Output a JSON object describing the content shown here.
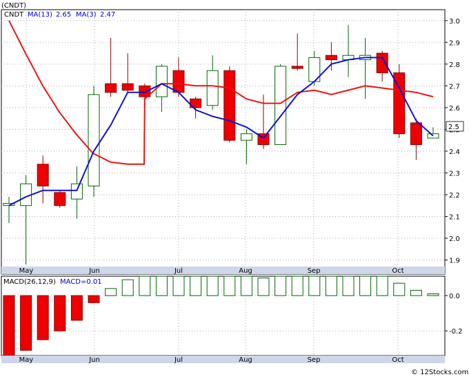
{
  "top_label": "(CNDT)",
  "copyright": "© 12Stocks.com",
  "chart_data": [
    {
      "type": "candlestick",
      "header": {
        "symbol": "CNDT",
        "ma13_label": "MA(13)",
        "ma13_value": "2.65",
        "ma3_label": "MA(3)",
        "ma3_value": "2.47"
      },
      "ylim": [
        1.87,
        3.05
      ],
      "yticks": [
        "3.0",
        "2.9",
        "2.8",
        "2.7",
        "2.6",
        "2.5",
        "2.4",
        "2.3",
        "2.2",
        "2.1",
        "2.0",
        "1.9"
      ],
      "last_price_label": "2.5",
      "months": [
        "May",
        "Jun",
        "Jul",
        "Aug",
        "Sep",
        "Oct"
      ],
      "candles": [
        {
          "o": 2.15,
          "h": 2.19,
          "l": 2.07,
          "c": 2.16
        },
        {
          "o": 2.15,
          "h": 2.29,
          "l": 1.88,
          "c": 2.25
        },
        {
          "o": 2.34,
          "h": 2.38,
          "l": 2.16,
          "c": 2.24
        },
        {
          "o": 2.21,
          "h": 2.22,
          "l": 2.14,
          "c": 2.15
        },
        {
          "o": 2.18,
          "h": 2.33,
          "l": 2.09,
          "c": 2.25
        },
        {
          "o": 2.24,
          "h": 2.7,
          "l": 2.19,
          "c": 2.66
        },
        {
          "o": 2.71,
          "h": 2.92,
          "l": 2.65,
          "c": 2.67
        },
        {
          "o": 2.71,
          "h": 2.85,
          "l": 2.67,
          "c": 2.68
        },
        {
          "o": 2.7,
          "h": 2.71,
          "l": 2.56,
          "c": 2.65
        },
        {
          "o": 2.65,
          "h": 2.8,
          "l": 2.58,
          "c": 2.79
        },
        {
          "o": 2.77,
          "h": 2.83,
          "l": 2.65,
          "c": 2.67
        },
        {
          "o": 2.64,
          "h": 2.65,
          "l": 2.55,
          "c": 2.6
        },
        {
          "o": 2.61,
          "h": 2.84,
          "l": 2.59,
          "c": 2.77
        },
        {
          "o": 2.77,
          "h": 2.79,
          "l": 2.44,
          "c": 2.45
        },
        {
          "o": 2.45,
          "h": 2.5,
          "l": 2.34,
          "c": 2.48
        },
        {
          "o": 2.48,
          "h": 2.66,
          "l": 2.41,
          "c": 2.43
        },
        {
          "o": 2.43,
          "h": 2.8,
          "l": 2.43,
          "c": 2.79
        },
        {
          "o": 2.79,
          "h": 2.94,
          "l": 2.77,
          "c": 2.78
        },
        {
          "o": 2.72,
          "h": 2.86,
          "l": 2.7,
          "c": 2.83
        },
        {
          "o": 2.84,
          "h": 2.9,
          "l": 2.77,
          "c": 2.82
        },
        {
          "o": 2.82,
          "h": 2.98,
          "l": 2.74,
          "c": 2.84
        },
        {
          "o": 2.82,
          "h": 2.92,
          "l": 2.64,
          "c": 2.84
        },
        {
          "o": 2.85,
          "h": 2.86,
          "l": 2.72,
          "c": 2.76
        },
        {
          "o": 2.76,
          "h": 2.8,
          "l": 2.46,
          "c": 2.48
        },
        {
          "o": 2.53,
          "h": 2.55,
          "l": 2.36,
          "c": 2.43
        },
        {
          "o": 2.46,
          "h": 2.51,
          "l": 2.46,
          "c": 2.48
        }
      ],
      "ma13": [
        null,
        null,
        null,
        null,
        null,
        2.41,
        2.66,
        2.66,
        2.64,
        2.71,
        2.71,
        2.7,
        2.7,
        2.69,
        2.64,
        2.62,
        2.62,
        2.67,
        2.68,
        2.66,
        2.68,
        2.7,
        2.69,
        2.68,
        2.67,
        2.65
      ],
      "ma13_extra": {
        "start": [
          3.0,
          2.85,
          2.7,
          2.58,
          2.48
        ],
        "flat": [
          2.39,
          2.35,
          2.34
        ]
      },
      "ma3": [
        2.15,
        2.19,
        2.22,
        2.22,
        2.22,
        2.4,
        2.52,
        2.67,
        2.67,
        2.71,
        2.67,
        2.59,
        2.56,
        2.54,
        2.51,
        2.46,
        2.56,
        2.66,
        2.72,
        2.8,
        2.82,
        2.83,
        2.83,
        2.69,
        2.54,
        2.47
      ]
    },
    {
      "type": "bar",
      "header": {
        "macd_label": "MACD(26,12,9)",
        "macd_value_label": "MACD=0.01"
      },
      "ylim": [
        -0.34,
        0.11
      ],
      "yticks": [
        "0.0",
        "-0.2"
      ],
      "months": [
        "May",
        "Jun",
        "Jul",
        "Aug",
        "Sep",
        "Oct"
      ],
      "values": [
        -0.36,
        -0.31,
        -0.25,
        -0.2,
        -0.14,
        -0.04,
        0.04,
        0.09,
        0.12,
        0.15,
        0.16,
        0.16,
        0.16,
        0.14,
        0.12,
        0.1,
        0.12,
        0.14,
        0.15,
        0.15,
        0.15,
        0.15,
        0.13,
        0.07,
        0.03,
        0.01
      ]
    }
  ]
}
